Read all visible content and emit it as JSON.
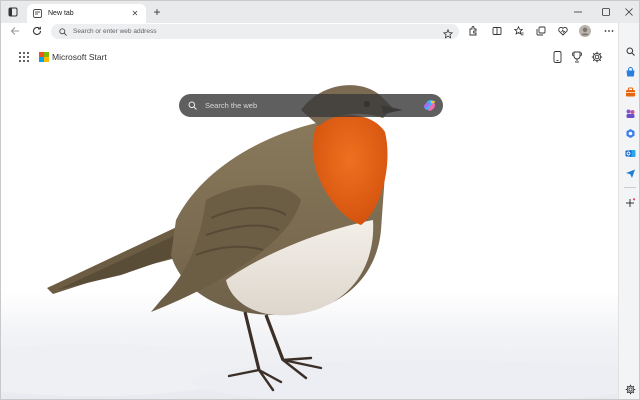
{
  "tabs": [
    {
      "title": "New tab"
    }
  ],
  "address_bar": {
    "placeholder": "Search or enter web address"
  },
  "header": {
    "brand": "Microsoft Start"
  },
  "search": {
    "placeholder": "Search the web"
  },
  "colors": {
    "accent": "#0c59a4",
    "robin_breast": "#e85f12",
    "copilot": "#2c8df0"
  },
  "icons": {
    "tab_strip": [
      "tab-actions-icon",
      "new-tab-icon"
    ],
    "window_controls": [
      "minimize-icon",
      "maximize-icon",
      "close-icon"
    ],
    "toolbar": [
      "back-icon",
      "refresh-icon",
      "favorite-star-icon",
      "extensions-icon",
      "split-screen-icon",
      "favorites-icon",
      "collections-icon",
      "browser-essentials-icon",
      "profile-icon",
      "more-icon",
      "copilot-icon"
    ],
    "content": [
      "apps-icon",
      "phone-icon",
      "rewards-icon",
      "settings-icon"
    ],
    "sidebar": [
      "sidebar-search-icon",
      "shopping-icon",
      "tools-icon",
      "games-icon",
      "outlook-icon",
      "send-icon",
      "add-icon",
      "sidebar-settings-icon"
    ]
  }
}
